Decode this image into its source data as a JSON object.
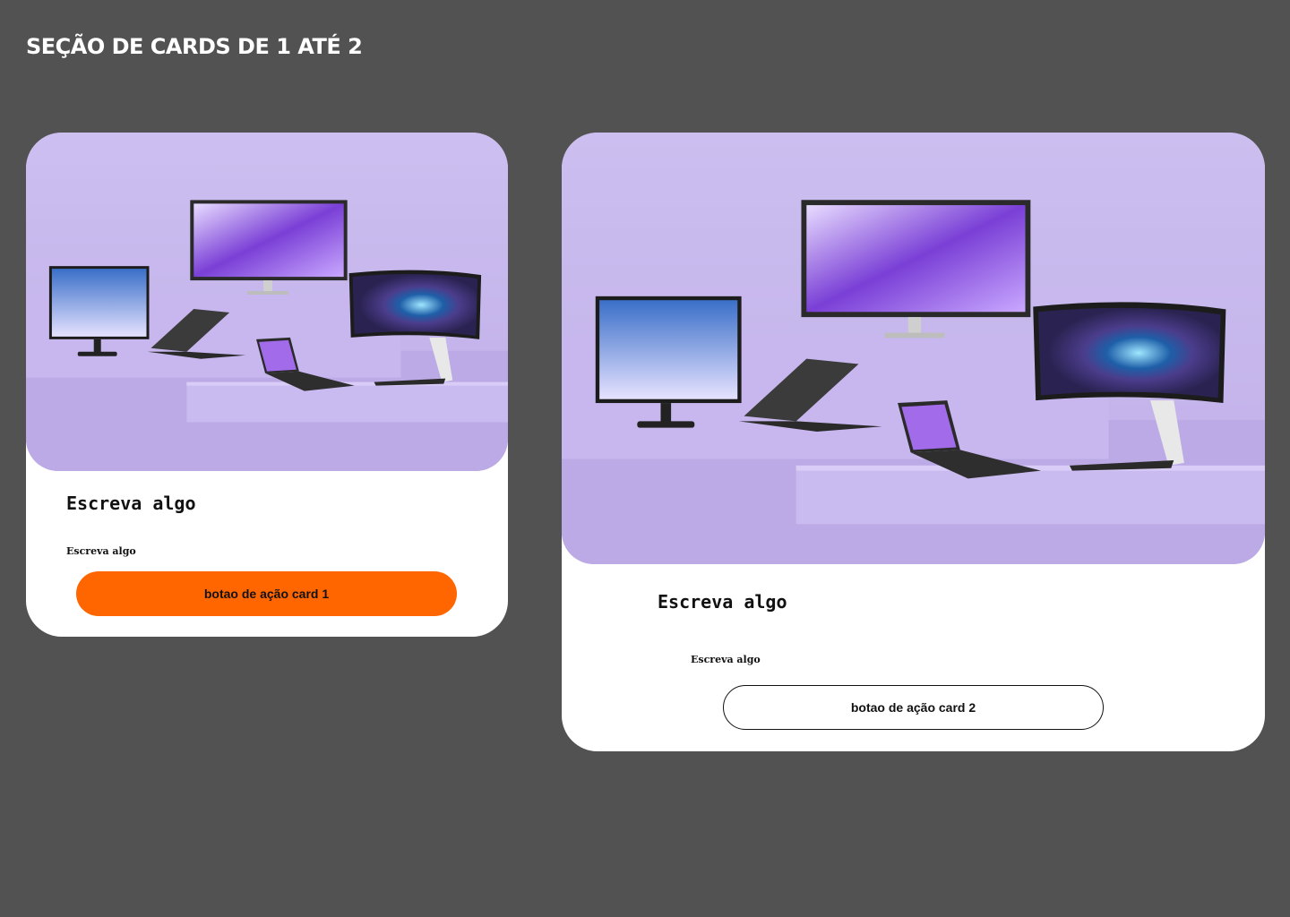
{
  "page": {
    "title": "Seção de cards de 1 até 2",
    "background": "#525252"
  },
  "cards": [
    {
      "image_alt": "monitores e notebooks",
      "heading": "Escreva algo",
      "text": "Escreva algo",
      "button_label": "botao de ação card 1",
      "button_color": "#ff6600"
    },
    {
      "image_alt": "monitores e notebooks",
      "heading": "Escreva algo",
      "text": "Escreva algo",
      "button_label": "botao de ação card 2",
      "button_color": "#ffffff"
    }
  ]
}
